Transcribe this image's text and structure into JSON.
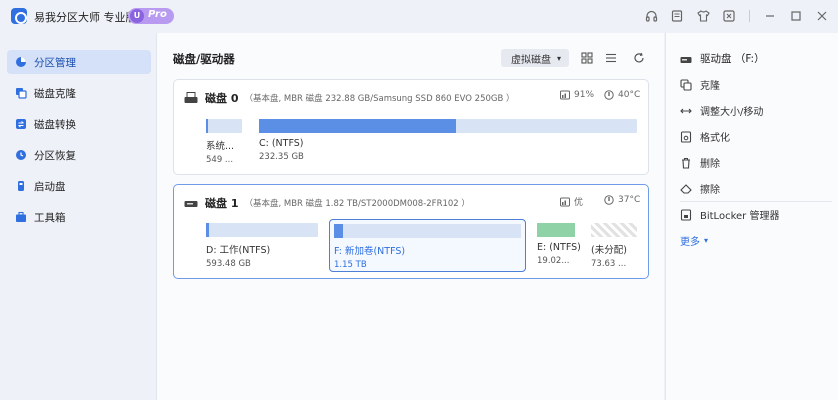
{
  "app": {
    "title": "易我分区大师 专业版",
    "badge_u": "U",
    "badge_pro": "Pro"
  },
  "sidebar": {
    "items": [
      {
        "label": "分区管理",
        "icon": "partition-manage-icon",
        "active": true
      },
      {
        "label": "磁盘克隆",
        "icon": "disk-clone-icon"
      },
      {
        "label": "磁盘转换",
        "icon": "disk-convert-icon"
      },
      {
        "label": "分区恢复",
        "icon": "partition-recover-icon"
      },
      {
        "label": "启动盘",
        "icon": "boot-disk-icon"
      },
      {
        "label": "工具箱",
        "icon": "toolbox-icon"
      }
    ]
  },
  "main": {
    "title": "磁盘/驱动器",
    "view_select": "虚拟磁盘"
  },
  "disks": [
    {
      "name": "磁盘 0",
      "info": "（基本盘, MBR 磁盘 232.88 GB/Samsung SSD 860 EVO 250GB ）",
      "health": "91%",
      "temp": "40°C",
      "partitions": [
        {
          "name": "系统...",
          "size": "549 ...",
          "fill": 0.05
        },
        {
          "name": "C: (NTFS)",
          "size": "232.35 GB",
          "fill": 0.52
        }
      ]
    },
    {
      "name": "磁盘 1",
      "info": "（基本盘, MBR 磁盘 1.82 TB/ST2000DM008-2FR102 ）",
      "health": "优",
      "temp": "37°C",
      "partitions": [
        {
          "name": "D: 工作(NTFS)",
          "size": "593.48 GB",
          "fill": 0.03
        },
        {
          "name": "F: 新加卷(NTFS)",
          "size": "1.15 TB",
          "fill": 0.05,
          "selected": true
        },
        {
          "name": "E: (NTFS)",
          "size": "19.02...",
          "fill": 1.0
        },
        {
          "name": "(未分配)",
          "size": "73.63 ..."
        }
      ]
    }
  ],
  "rpanel": {
    "drive": "驱动盘 （F:）",
    "actions": [
      "克隆",
      "调整大小/移动",
      "格式化",
      "删除",
      "擦除"
    ],
    "bitlocker": "BitLocker 管理器",
    "more": "更多"
  },
  "colors": {
    "accent": "#2f6fe0",
    "bar_bg": "#d8e3f5",
    "bar_fill": "#5b8fe6",
    "bar_fill_green": "#8fd2a6",
    "active_nav_bg": "#d4e1f8"
  }
}
